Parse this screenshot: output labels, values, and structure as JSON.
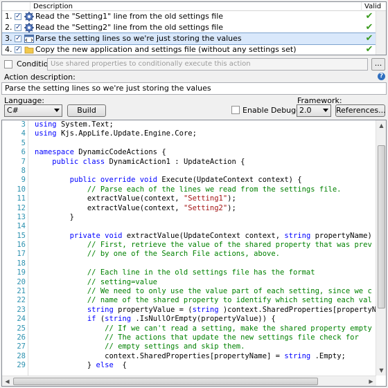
{
  "list": {
    "header": {
      "description": "Description",
      "valid": "Valid"
    },
    "rows": [
      {
        "num": "1.",
        "icon": "gear-icon",
        "label": "Read the \"Setting1\" line from the old settings file",
        "valid": "✔"
      },
      {
        "num": "2.",
        "icon": "gear-icon",
        "label": "Read the \"Setting2\" line from the old settings file",
        "valid": "✔"
      },
      {
        "num": "3.",
        "icon": "code-icon",
        "label": "Parse the setting lines so we're just storing the values",
        "valid": "✔"
      },
      {
        "num": "4.",
        "icon": "folder-icon",
        "label": "Copy the new application and settings file (without any settings set)",
        "valid": "✔"
      }
    ]
  },
  "condition": {
    "label": "Condition:",
    "placeholder": "Use shared properties to conditionally execute this action",
    "browse": "..."
  },
  "action": {
    "label": "Action description:",
    "help": "?",
    "value": "Parse the setting lines so we're just storing the values"
  },
  "language": {
    "label": "Language:",
    "value": "C#"
  },
  "build": "Build",
  "debugging": "Enable Debugging",
  "framework": {
    "label": "Framework:",
    "value": "2.0"
  },
  "references": "References...",
  "code": [
    {
      "n": "3",
      "parts": [
        [
          "kw",
          "using"
        ],
        [
          "",
          "System.Text;"
        ]
      ]
    },
    {
      "n": "4",
      "parts": [
        [
          "kw",
          "using"
        ],
        [
          "",
          "Kjs.AppLife.Update.Engine.Core;"
        ]
      ]
    },
    {
      "n": "5",
      "parts": []
    },
    {
      "n": "6",
      "parts": [
        [
          "kw",
          "namespace"
        ],
        [
          "",
          "DynamicCodeActions {"
        ]
      ]
    },
    {
      "n": "7",
      "parts": [
        [
          "",
          "    "
        ],
        [
          "kw",
          "public class"
        ],
        [
          "",
          "DynamicAction1 : UpdateAction {"
        ]
      ]
    },
    {
      "n": "8",
      "parts": []
    },
    {
      "n": "9",
      "parts": [
        [
          "",
          "        "
        ],
        [
          "kw",
          "public override void"
        ],
        [
          "",
          "Execute(UpdateContext context) {"
        ]
      ]
    },
    {
      "n": "10",
      "parts": [
        [
          "",
          "            "
        ],
        [
          "cm",
          "// Parse each of the lines we read from the settings file."
        ]
      ]
    },
    {
      "n": "11",
      "parts": [
        [
          "",
          "            extractValue(context, "
        ],
        [
          "st",
          "\"Setting1\""
        ],
        [
          "",
          ");"
        ]
      ]
    },
    {
      "n": "12",
      "parts": [
        [
          "",
          "            extractValue(context, "
        ],
        [
          "st",
          "\"Setting2\""
        ],
        [
          "",
          ");"
        ]
      ]
    },
    {
      "n": "13",
      "parts": [
        [
          "",
          "        }"
        ]
      ]
    },
    {
      "n": "14",
      "parts": []
    },
    {
      "n": "15",
      "parts": [
        [
          "",
          "        "
        ],
        [
          "kw",
          "private void"
        ],
        [
          "",
          "extractValue(UpdateContext context, "
        ],
        [
          "kw",
          "string"
        ],
        [
          "",
          "propertyName)"
        ]
      ]
    },
    {
      "n": "16",
      "parts": [
        [
          "",
          "            "
        ],
        [
          "cm",
          "// First, retrieve the value of the shared property that was prev"
        ]
      ]
    },
    {
      "n": "17",
      "parts": [
        [
          "",
          "            "
        ],
        [
          "cm",
          "// by one of the Search File actions, above."
        ]
      ]
    },
    {
      "n": "18",
      "parts": []
    },
    {
      "n": "19",
      "parts": [
        [
          "",
          "            "
        ],
        [
          "cm",
          "// Each line in the old settings file has the format"
        ]
      ]
    },
    {
      "n": "20",
      "parts": [
        [
          "",
          "            "
        ],
        [
          "cm",
          "// setting=value"
        ]
      ]
    },
    {
      "n": "21",
      "parts": [
        [
          "",
          "            "
        ],
        [
          "cm",
          "// We need to only use the value part of each setting, since we c"
        ]
      ]
    },
    {
      "n": "22",
      "parts": [
        [
          "",
          "            "
        ],
        [
          "cm",
          "// name of the shared property to identify which setting each val"
        ]
      ]
    },
    {
      "n": "23",
      "parts": [
        [
          "",
          "            "
        ],
        [
          "kw",
          "string"
        ],
        [
          "",
          "propertyValue = ("
        ],
        [
          "kw",
          "string"
        ],
        [
          "",
          ")context.SharedProperties[propertyN"
        ]
      ]
    },
    {
      "n": "24",
      "parts": [
        [
          "",
          "            "
        ],
        [
          "kw",
          "if"
        ],
        [
          "",
          "("
        ],
        [
          "kw",
          "string"
        ],
        [
          "",
          ".IsNullOrEmpty(propertyValue)) {"
        ]
      ]
    },
    {
      "n": "25",
      "parts": [
        [
          "",
          "                "
        ],
        [
          "cm",
          "// If we can't read a setting, make the shared property empty"
        ]
      ]
    },
    {
      "n": "26",
      "parts": [
        [
          "",
          "                "
        ],
        [
          "cm",
          "// The actions that update the new settings file check for"
        ]
      ]
    },
    {
      "n": "27",
      "parts": [
        [
          "",
          "                "
        ],
        [
          "cm",
          "// empty settings and skip them."
        ]
      ]
    },
    {
      "n": "28",
      "parts": [
        [
          "",
          "                context.SharedProperties[propertyName] = "
        ],
        [
          "kw",
          "string"
        ],
        [
          "",
          ".Empty;"
        ]
      ]
    },
    {
      "n": "29",
      "parts": [
        [
          "",
          "            } "
        ],
        [
          "kw",
          "else"
        ],
        [
          "",
          " {"
        ]
      ]
    }
  ],
  "colors": {
    "keyword": "#0000ff",
    "comment": "#008000",
    "string": "#a31515",
    "line_number": "#2b91af",
    "selection": "#d9e8fb"
  }
}
